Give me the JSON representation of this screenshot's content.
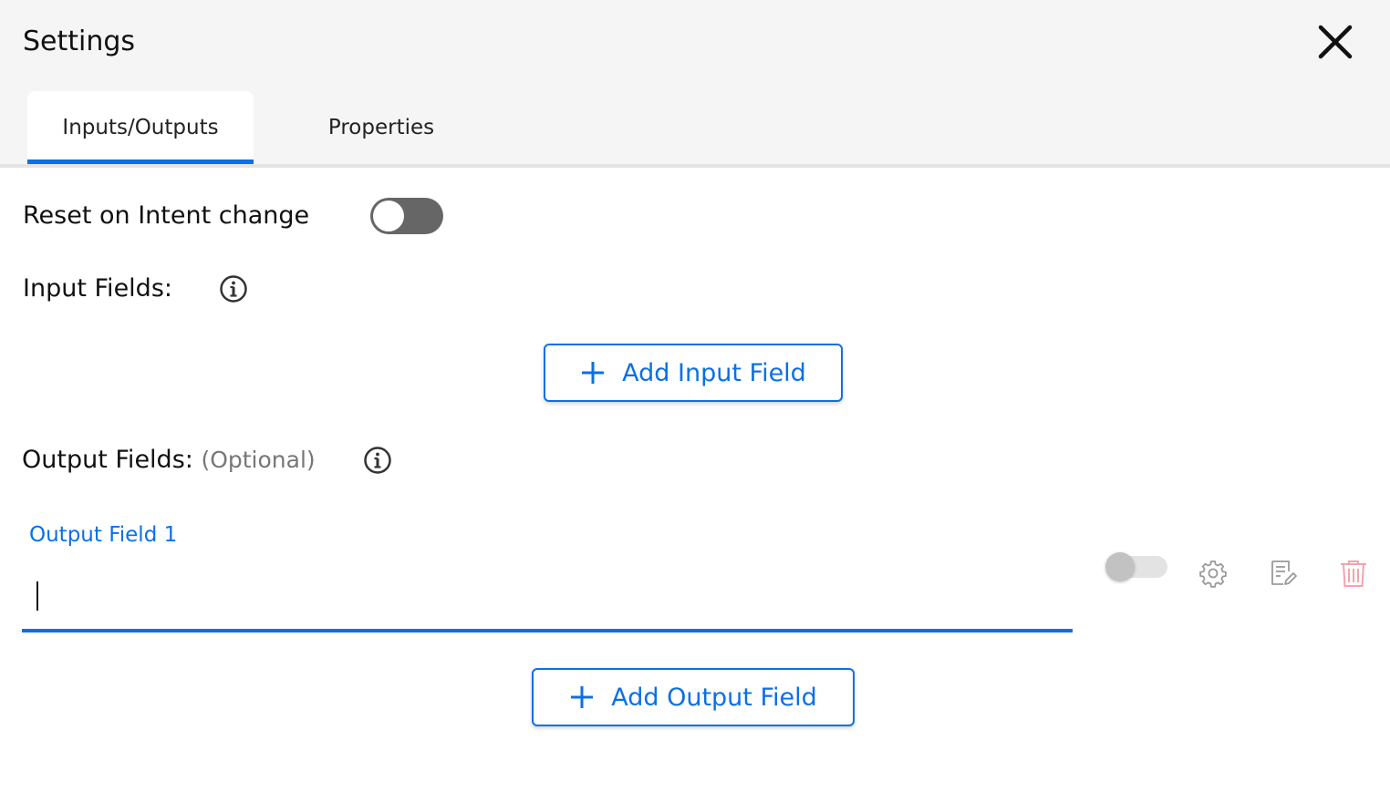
{
  "header": {
    "title": "Settings",
    "close_icon": "close-icon"
  },
  "tabs": [
    {
      "label": "Inputs/Outputs",
      "active": true
    },
    {
      "label": "Properties",
      "active": false
    }
  ],
  "reset": {
    "label": "Reset on Intent change",
    "enabled": false
  },
  "input_fields": {
    "label": "Input Fields:",
    "info_icon": "info-icon",
    "add_button": "Add Input Field"
  },
  "output_fields": {
    "label": "Output Fields:",
    "optional": "(Optional)",
    "info_icon": "info-icon",
    "add_button": "Add Output Field",
    "fields": [
      {
        "label": "Output Field 1",
        "value": "",
        "toggle_enabled": false,
        "icons": [
          "gear-icon",
          "edit-note-icon",
          "trash-icon"
        ]
      }
    ]
  },
  "colors": {
    "accent": "#0b6fe8",
    "header_bg": "#f5f5f5",
    "toggle_off": "#666666",
    "danger": "#f4a3ad",
    "muted_icon": "#9a9a9a"
  }
}
